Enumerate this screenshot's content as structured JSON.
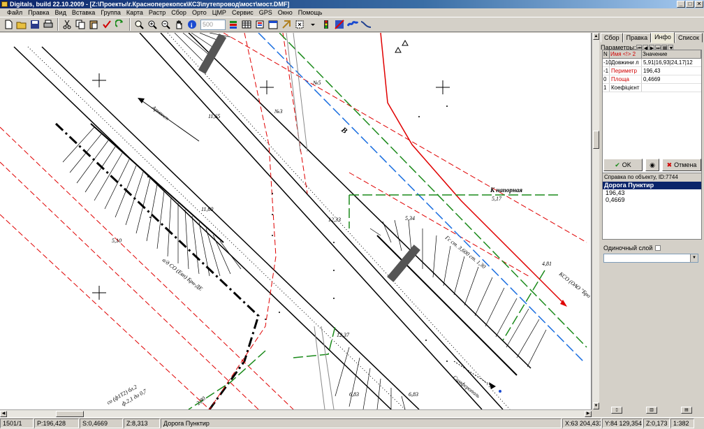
{
  "window": {
    "title": "Digitals, build 22.10.2009 - [Z:\\Проекты\\г.Красноперекопск\\КСЗ\\путепровод\\мост\\мост.DMF]",
    "buttons": [
      "_",
      "□",
      "✕"
    ]
  },
  "menu": [
    "Файл",
    "Правка",
    "Вид",
    "Вставка",
    "Группа",
    "Карта",
    "Растр",
    "Сбор",
    "Орто",
    "ЦМР",
    "Сервис",
    "GPS",
    "Окно",
    "Помощь"
  ],
  "toolbar": {
    "scale_input_value": "500"
  },
  "map": {
    "labels": {
      "direction_left": "Армянск",
      "direction_bottom": "Симферополь",
      "pressure": "К напорная",
      "road_left": "а/д СО (Евп) Брн-ДЕ",
      "road_right": "КСО (ОАО \"Бро",
      "fuel_label": "Гс ст. 3,600 ст. 1,30",
      "b_label": "В",
      "n5": "№5",
      "n3": "№3",
      "h1": "11,65",
      "h2": "11,60",
      "h3": "5,10",
      "h4": "12,33",
      "h5": "5,34",
      "h6": "4,81",
      "h7": "12,37",
      "h8": "6,83",
      "h9": "6,83",
      "h10": "5,17",
      "h11": "2,80",
      "sw_label": "со (ф1Т2) бл.2",
      "sw_label2": "ф.2,1 до 0,7"
    },
    "colors": {
      "red": "#e00000",
      "green": "#1a8a1a",
      "blue": "#1a6ee0",
      "black": "#000000"
    }
  },
  "panel": {
    "tabs": [
      "Сбор",
      "Правка",
      "Инфо",
      "Список"
    ],
    "active_tab": "Инфо",
    "params_label": "Параметры:",
    "grid_headers": [
      "N",
      "Имя <!> 2",
      "Значение"
    ],
    "rows": [
      {
        "n": "-10",
        "name": "Довжини л",
        "value": "5,91|16,93|24,17|12"
      },
      {
        "n": "-1",
        "name": "Периметр",
        "value": "196,43"
      },
      {
        "n": "0",
        "name": "Площа",
        "value": "0,4669"
      },
      {
        "n": "1",
        "name": "Коефіцієнт",
        "value": ""
      }
    ],
    "ok_label": "OK",
    "cancel_label": "Отмена",
    "info_title": "Справка по объекту, ID:7744",
    "info_selected": "Дорога Пунктир",
    "info_lines": [
      "196,43",
      "0,4669"
    ],
    "single_layer_label": "Одиночный слой"
  },
  "status": {
    "cells": [
      "1501/1",
      "P:196,428",
      "S:0,4669",
      "Z:8,313",
      "Дорога Пунктир"
    ],
    "coords": [
      "X:63 204,431",
      "Y:84 129,354",
      "Z:0,173",
      "1:382"
    ]
  }
}
